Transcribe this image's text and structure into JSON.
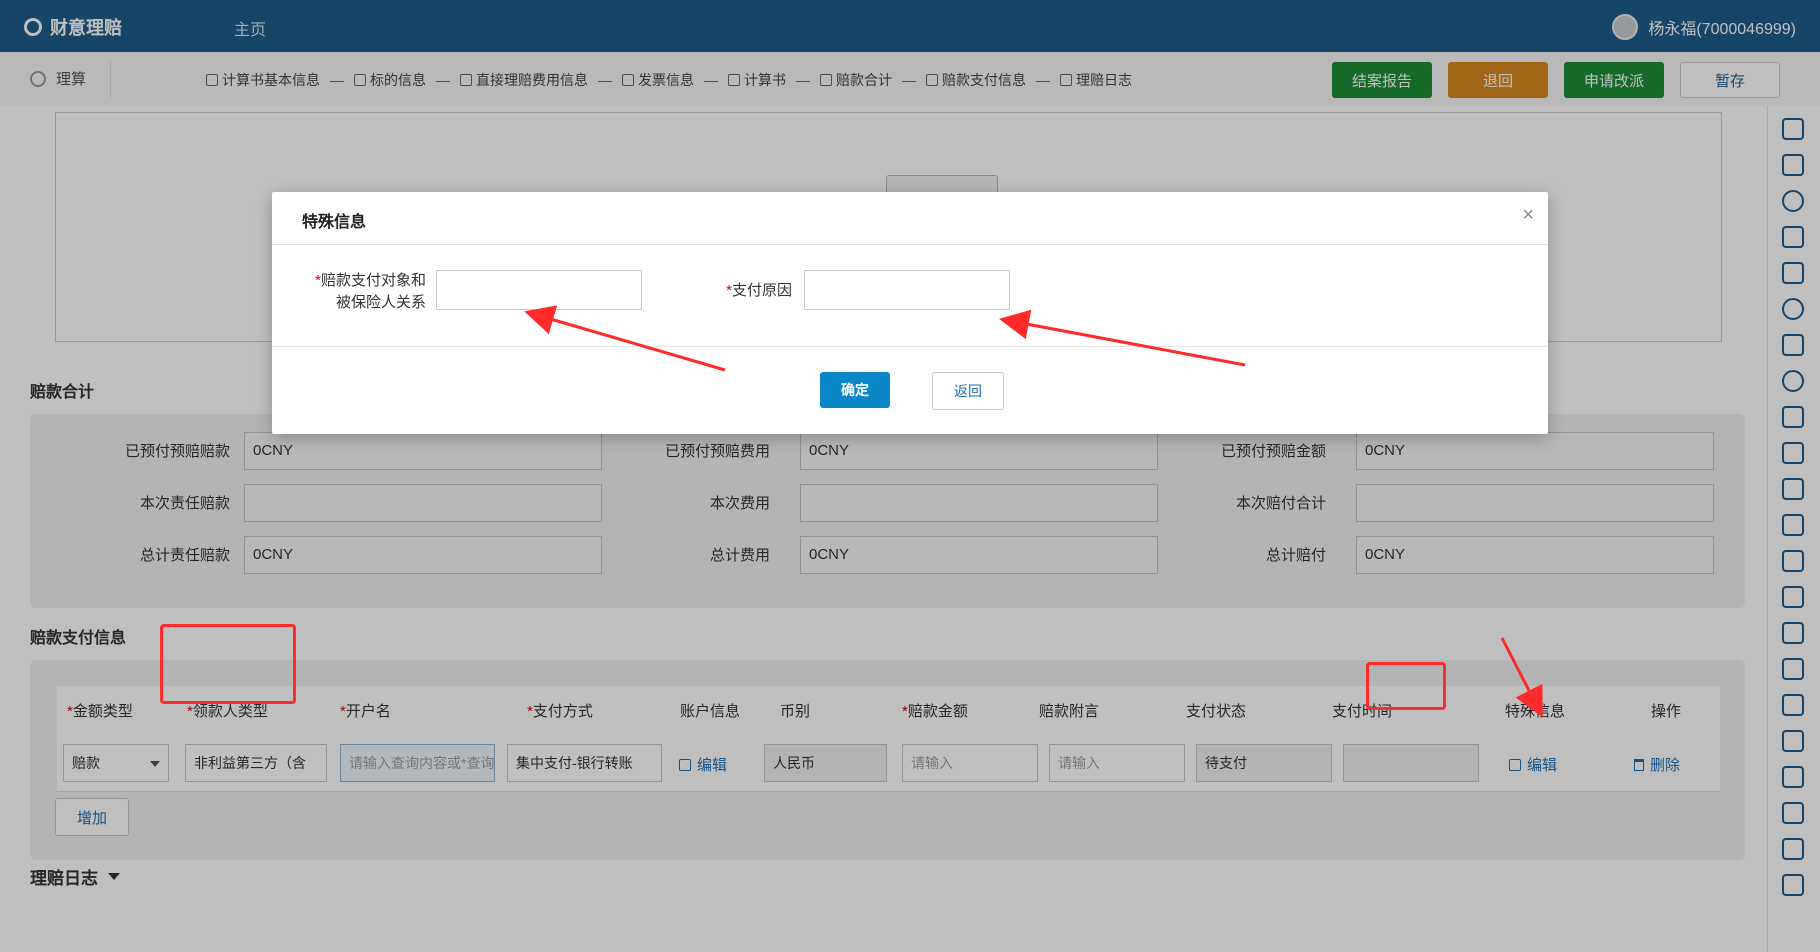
{
  "header": {
    "brand": "财意理赔",
    "home": "主页",
    "user": "杨永福(7000046999)"
  },
  "subbar": {
    "left_label": "理算",
    "steps": [
      "计算书基本信息",
      "标的信息",
      "直接理赔费用信息",
      "发票信息",
      "计算书",
      "赔款合计",
      "赔款支付信息",
      "理赔日志"
    ],
    "step_separator": "—",
    "buttons": {
      "report": "结案报告",
      "return": "退回",
      "apply": "申请改派",
      "save": "暂存"
    }
  },
  "summary": {
    "title": "赔款合计",
    "rows": [
      {
        "l1": "已预付预赔赔款",
        "v1": "0CNY",
        "l2": "已预付预赔费用",
        "v2": "0CNY",
        "l3": "已预付预赔金额",
        "v3": "0CNY"
      },
      {
        "l1": "本次责任赔款",
        "v1": "",
        "l2": "本次费用",
        "v2": "",
        "l3": "本次赔付合计",
        "v3": ""
      },
      {
        "l1": "总计责任赔款",
        "v1": "0CNY",
        "l2": "总计费用",
        "v2": "0CNY",
        "l3": "总计赔付",
        "v3": "0CNY"
      }
    ]
  },
  "payment": {
    "title": "赔款支付信息",
    "required_mark": "*",
    "headers": {
      "amount_type": "金额类型",
      "payee_type": "领款人类型",
      "account_name": "开户名",
      "pay_method": "支付方式",
      "account_info": "账户信息",
      "currency": "币别",
      "amount": "赔款金额",
      "note": "赔款附言",
      "status": "支付状态",
      "time": "支付时间",
      "special": "特殊信息",
      "op": "操作"
    },
    "row": {
      "amount_type": "赔款",
      "payee_type": "非利益第三方（含",
      "account_name_placeholder": "请输入查询内容或*查询:",
      "pay_method": "集中支付-银行转账",
      "account_edit": "编辑",
      "currency": "人民币",
      "amount_placeholder": "请输入",
      "note_placeholder": "请输入",
      "status": "待支付",
      "time": "",
      "special_edit": "编辑",
      "delete": "删除"
    },
    "add": "增加"
  },
  "log": {
    "title": "理赔日志"
  },
  "modal": {
    "title": "特殊信息",
    "close": "×",
    "field1_label_line1": "赔款支付对象和",
    "field1_label_line2": "被保险人关系",
    "field2_label": "支付原因",
    "required_mark": "*",
    "confirm": "确定",
    "back": "返回"
  },
  "colors": {
    "header_bg": "#1f5d8a",
    "btn_green": "#1e8e34",
    "btn_orange": "#d98a1f",
    "confirm_blue": "#0b86c6",
    "annotation_red": "#ff2a2a"
  }
}
